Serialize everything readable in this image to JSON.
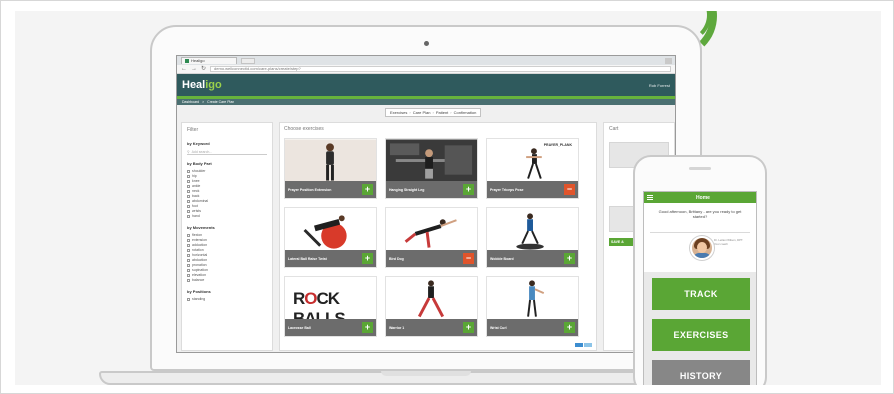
{
  "browser": {
    "tab_title": "Healigo",
    "url": "demo.wellconnectid.com/care-plans/create/step?"
  },
  "app": {
    "logo_main": "Heal",
    "logo_accent": "igo",
    "user_menu": "Rob Forrest"
  },
  "breadcrumb": {
    "items": [
      "Dashboard",
      ">",
      "Create Care Plan"
    ]
  },
  "wizard": {
    "steps": [
      "Exercises",
      "Care Plan",
      "Patient",
      "Confirmation"
    ],
    "separator": "›"
  },
  "filter": {
    "title": "Filter",
    "keyword_heading": "by Keyword",
    "keyword_placeholder": "Add search...",
    "body_part_heading": "by Body Part",
    "body_parts": [
      "shoulder",
      "hip",
      "knee",
      "ankle",
      "neck",
      "back",
      "abdominal",
      "foot",
      "wrists",
      "hand"
    ],
    "movements_heading": "by Movements",
    "movements": [
      "flexion",
      "extension",
      "adduction",
      "rotation",
      "horizontal",
      "abduction",
      "pronation",
      "supination",
      "elevation",
      "balance"
    ],
    "positions_heading": "by Positions",
    "positions": [
      "standing"
    ]
  },
  "exercises": {
    "title": "Choose exercises",
    "cards": [
      {
        "name": "Prayer Position Extension",
        "action": "+",
        "kind": "add"
      },
      {
        "name": "Hanging Straight Leg",
        "action": "+",
        "kind": "add"
      },
      {
        "name": "Prayer Triceps Pose",
        "action": "−",
        "kind": "remove"
      },
      {
        "name": "Lateral Ball Raise Twist",
        "action": "+",
        "kind": "add"
      },
      {
        "name": "Bird Dog",
        "action": "−",
        "kind": "remove"
      },
      {
        "name": "Wobble Board",
        "action": "+",
        "kind": "add"
      },
      {
        "name": "Lacrosse Ball",
        "action": "+",
        "kind": "add"
      },
      {
        "name": "Warrior 1",
        "action": "+",
        "kind": "add"
      },
      {
        "name": "Wrist Curl",
        "action": "+",
        "kind": "add"
      }
    ],
    "card3_label": "PRAYER_PLANK",
    "card7_art": {
      "part1": "R",
      "part2": "O",
      "part3": "CK",
      "part4": "BALLS"
    }
  },
  "cart": {
    "title": "Cart",
    "save_label": "SAVE &"
  },
  "phone": {
    "title": "Home",
    "greeting": "Good afternoon, Brittany - are you ready to get started?",
    "coach_note": "Dr. Leilani Wilson, DPT. Your coach",
    "track_label": "TRACK",
    "exercises_label": "EXERCISES",
    "history_label": "HISTORY"
  },
  "colors": {
    "brand_green": "#5aa635",
    "header_teal": "#2f5a5d",
    "remove_orange": "#e0542b",
    "history_gray": "#878787"
  }
}
